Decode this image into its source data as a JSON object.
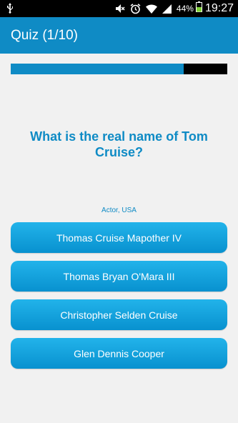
{
  "status_bar": {
    "battery_percent": "44%",
    "time": "19:27",
    "icons": [
      "usb-icon",
      "mute-icon",
      "alarm-icon",
      "wifi-icon",
      "signal-icon",
      "battery-icon"
    ]
  },
  "app_bar": {
    "title": "Quiz (1/10)"
  },
  "progress": {
    "value": 0.8
  },
  "question": {
    "text": "What is the real name of Tom Cruise?"
  },
  "hint": "Actor, USA",
  "answers": [
    "Thomas Cruise Mapother IV",
    "Thomas Bryan O'Mara III",
    "Christopher Selden Cruise",
    "Glen Dennis Cooper"
  ],
  "colors": {
    "accent": "#0f8bc5",
    "button": "#1aa5e0",
    "background": "#f1f1f1"
  }
}
